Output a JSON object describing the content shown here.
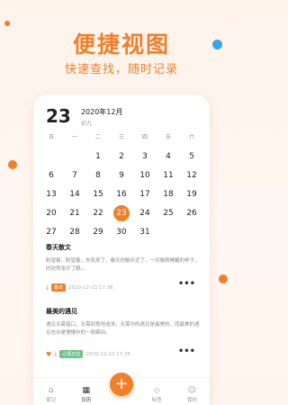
{
  "promo": {
    "title": "便捷视图",
    "subtitle": "快速查找，随时记录"
  },
  "calendar": {
    "day": "23",
    "year_month": "2020年12月",
    "lunar": "初九",
    "weekdays": [
      "日",
      "一",
      "二",
      "三",
      "四",
      "五",
      "六"
    ],
    "rows": [
      [
        "",
        "",
        "1",
        "2",
        "3",
        "4",
        "5"
      ],
      [
        "6",
        "7",
        "8",
        "9",
        "10",
        "11",
        "12"
      ],
      [
        "13",
        "14",
        "15",
        "16",
        "17",
        "18",
        "19"
      ],
      [
        "20",
        "21",
        "22",
        "23",
        "24",
        "25",
        "26"
      ],
      [
        "27",
        "28",
        "29",
        "30",
        "31",
        "",
        ""
      ]
    ],
    "selected": "23"
  },
  "notes": [
    {
      "title": "春天散文",
      "body": "盼望着，盼望着，东风来了，春天的脚步近了。一切像刚睡醒的样子，欣欣然张开了眼。。",
      "tag": "春天",
      "time": "2020-12-23  17:36"
    },
    {
      "title": "最美的遇见",
      "body": "遇见无需借口，无需刻意地追求。无需中的遇见是最美的，而最美的遇见也许是懵懂中的一段瞬间。",
      "tag": "心情日志",
      "time": "2020-12-23  17:36"
    }
  ],
  "tabbar": {
    "tabs": [
      "笔记",
      "日历",
      "",
      "标签",
      "我的"
    ],
    "fab": "+"
  },
  "colors": {
    "accent": "#f07f2a",
    "green_tag": "#6bc38b",
    "blue_dot": "#3aa3f0"
  }
}
